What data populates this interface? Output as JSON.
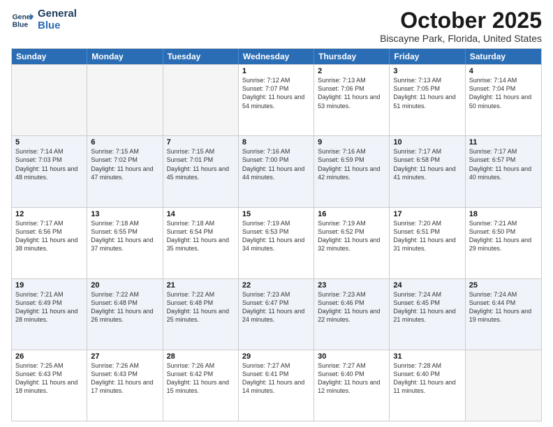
{
  "logo": {
    "line1": "General",
    "line2": "Blue"
  },
  "title": "October 2025",
  "location": "Biscayne Park, Florida, United States",
  "days": [
    "Sunday",
    "Monday",
    "Tuesday",
    "Wednesday",
    "Thursday",
    "Friday",
    "Saturday"
  ],
  "weeks": [
    [
      {
        "day": "",
        "empty": true
      },
      {
        "day": "",
        "empty": true
      },
      {
        "day": "",
        "empty": true
      },
      {
        "day": "1",
        "sunrise": "Sunrise: 7:12 AM",
        "sunset": "Sunset: 7:07 PM",
        "daylight": "Daylight: 11 hours and 54 minutes."
      },
      {
        "day": "2",
        "sunrise": "Sunrise: 7:13 AM",
        "sunset": "Sunset: 7:06 PM",
        "daylight": "Daylight: 11 hours and 53 minutes."
      },
      {
        "day": "3",
        "sunrise": "Sunrise: 7:13 AM",
        "sunset": "Sunset: 7:05 PM",
        "daylight": "Daylight: 11 hours and 51 minutes."
      },
      {
        "day": "4",
        "sunrise": "Sunrise: 7:14 AM",
        "sunset": "Sunset: 7:04 PM",
        "daylight": "Daylight: 11 hours and 50 minutes."
      }
    ],
    [
      {
        "day": "5",
        "sunrise": "Sunrise: 7:14 AM",
        "sunset": "Sunset: 7:03 PM",
        "daylight": "Daylight: 11 hours and 48 minutes."
      },
      {
        "day": "6",
        "sunrise": "Sunrise: 7:15 AM",
        "sunset": "Sunset: 7:02 PM",
        "daylight": "Daylight: 11 hours and 47 minutes."
      },
      {
        "day": "7",
        "sunrise": "Sunrise: 7:15 AM",
        "sunset": "Sunset: 7:01 PM",
        "daylight": "Daylight: 11 hours and 45 minutes."
      },
      {
        "day": "8",
        "sunrise": "Sunrise: 7:16 AM",
        "sunset": "Sunset: 7:00 PM",
        "daylight": "Daylight: 11 hours and 44 minutes."
      },
      {
        "day": "9",
        "sunrise": "Sunrise: 7:16 AM",
        "sunset": "Sunset: 6:59 PM",
        "daylight": "Daylight: 11 hours and 42 minutes."
      },
      {
        "day": "10",
        "sunrise": "Sunrise: 7:17 AM",
        "sunset": "Sunset: 6:58 PM",
        "daylight": "Daylight: 11 hours and 41 minutes."
      },
      {
        "day": "11",
        "sunrise": "Sunrise: 7:17 AM",
        "sunset": "Sunset: 6:57 PM",
        "daylight": "Daylight: 11 hours and 40 minutes."
      }
    ],
    [
      {
        "day": "12",
        "sunrise": "Sunrise: 7:17 AM",
        "sunset": "Sunset: 6:56 PM",
        "daylight": "Daylight: 11 hours and 38 minutes."
      },
      {
        "day": "13",
        "sunrise": "Sunrise: 7:18 AM",
        "sunset": "Sunset: 6:55 PM",
        "daylight": "Daylight: 11 hours and 37 minutes."
      },
      {
        "day": "14",
        "sunrise": "Sunrise: 7:18 AM",
        "sunset": "Sunset: 6:54 PM",
        "daylight": "Daylight: 11 hours and 35 minutes."
      },
      {
        "day": "15",
        "sunrise": "Sunrise: 7:19 AM",
        "sunset": "Sunset: 6:53 PM",
        "daylight": "Daylight: 11 hours and 34 minutes."
      },
      {
        "day": "16",
        "sunrise": "Sunrise: 7:19 AM",
        "sunset": "Sunset: 6:52 PM",
        "daylight": "Daylight: 11 hours and 32 minutes."
      },
      {
        "day": "17",
        "sunrise": "Sunrise: 7:20 AM",
        "sunset": "Sunset: 6:51 PM",
        "daylight": "Daylight: 11 hours and 31 minutes."
      },
      {
        "day": "18",
        "sunrise": "Sunrise: 7:21 AM",
        "sunset": "Sunset: 6:50 PM",
        "daylight": "Daylight: 11 hours and 29 minutes."
      }
    ],
    [
      {
        "day": "19",
        "sunrise": "Sunrise: 7:21 AM",
        "sunset": "Sunset: 6:49 PM",
        "daylight": "Daylight: 11 hours and 28 minutes."
      },
      {
        "day": "20",
        "sunrise": "Sunrise: 7:22 AM",
        "sunset": "Sunset: 6:48 PM",
        "daylight": "Daylight: 11 hours and 26 minutes."
      },
      {
        "day": "21",
        "sunrise": "Sunrise: 7:22 AM",
        "sunset": "Sunset: 6:48 PM",
        "daylight": "Daylight: 11 hours and 25 minutes."
      },
      {
        "day": "22",
        "sunrise": "Sunrise: 7:23 AM",
        "sunset": "Sunset: 6:47 PM",
        "daylight": "Daylight: 11 hours and 24 minutes."
      },
      {
        "day": "23",
        "sunrise": "Sunrise: 7:23 AM",
        "sunset": "Sunset: 6:46 PM",
        "daylight": "Daylight: 11 hours and 22 minutes."
      },
      {
        "day": "24",
        "sunrise": "Sunrise: 7:24 AM",
        "sunset": "Sunset: 6:45 PM",
        "daylight": "Daylight: 11 hours and 21 minutes."
      },
      {
        "day": "25",
        "sunrise": "Sunrise: 7:24 AM",
        "sunset": "Sunset: 6:44 PM",
        "daylight": "Daylight: 11 hours and 19 minutes."
      }
    ],
    [
      {
        "day": "26",
        "sunrise": "Sunrise: 7:25 AM",
        "sunset": "Sunset: 6:43 PM",
        "daylight": "Daylight: 11 hours and 18 minutes."
      },
      {
        "day": "27",
        "sunrise": "Sunrise: 7:26 AM",
        "sunset": "Sunset: 6:43 PM",
        "daylight": "Daylight: 11 hours and 17 minutes."
      },
      {
        "day": "28",
        "sunrise": "Sunrise: 7:26 AM",
        "sunset": "Sunset: 6:42 PM",
        "daylight": "Daylight: 11 hours and 15 minutes."
      },
      {
        "day": "29",
        "sunrise": "Sunrise: 7:27 AM",
        "sunset": "Sunset: 6:41 PM",
        "daylight": "Daylight: 11 hours and 14 minutes."
      },
      {
        "day": "30",
        "sunrise": "Sunrise: 7:27 AM",
        "sunset": "Sunset: 6:40 PM",
        "daylight": "Daylight: 11 hours and 12 minutes."
      },
      {
        "day": "31",
        "sunrise": "Sunrise: 7:28 AM",
        "sunset": "Sunset: 6:40 PM",
        "daylight": "Daylight: 11 hours and 11 minutes."
      },
      {
        "day": "",
        "empty": true
      }
    ]
  ]
}
